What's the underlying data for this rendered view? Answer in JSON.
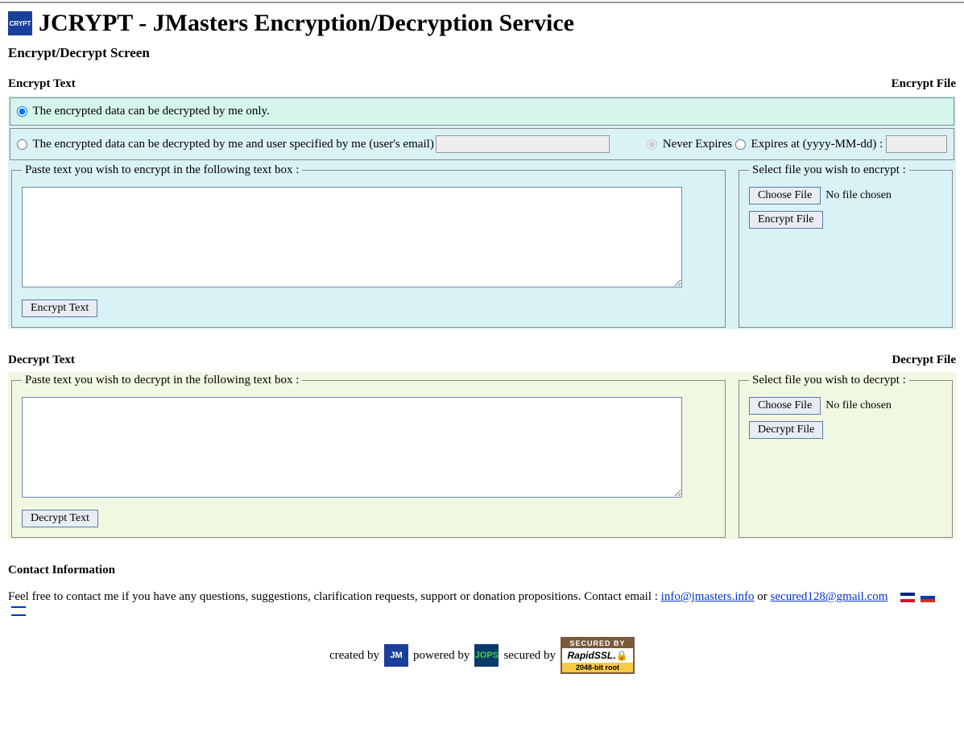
{
  "header": {
    "title": "JCRYPT - JMasters Encryption/Decryption Service",
    "subtitle": "Encrypt/Decrypt Screen"
  },
  "encrypt": {
    "text_heading": "Encrypt Text",
    "file_heading": "Encrypt File",
    "opt_me_only": "The encrypted data can be decrypted by me only.",
    "opt_me_and_user": "The encrypted data can be decrypted by me and user specified by me (user's email)",
    "never_expires": "Never Expires",
    "expires_at": "Expires at (yyyy-MM-dd) :",
    "fieldset_text_legend": "Paste text you wish to encrypt in the following text box :",
    "fieldset_file_legend": "Select file you wish to encrypt :",
    "choose_file": "Choose File",
    "no_file": "No file chosen",
    "encrypt_text_btn": "Encrypt Text",
    "encrypt_file_btn": "Encrypt File"
  },
  "decrypt": {
    "text_heading": "Decrypt Text",
    "file_heading": "Decrypt File",
    "fieldset_text_legend": "Paste text you wish to decrypt in the following text box :",
    "fieldset_file_legend": "Select file you wish to decrypt :",
    "choose_file": "Choose File",
    "no_file": "No file chosen",
    "decrypt_text_btn": "Decrypt Text",
    "decrypt_file_btn": "Decrypt File"
  },
  "contact": {
    "heading": "Contact Information",
    "line_prefix": "Feel free to contact me if you have any questions, suggestions, clarification requests, support or donation propositions. Contact email : ",
    "email1": "info@jmasters.info",
    "or": " or ",
    "email2": "secured128@gmail.com"
  },
  "footer": {
    "created_by": "created by",
    "powered_by": "powered by",
    "secured_by": "secured by",
    "rapidssl_top": "SECURED BY",
    "rapidssl_mid": "RapidSSL",
    "rapidssl_bot": "2048-bit root"
  }
}
